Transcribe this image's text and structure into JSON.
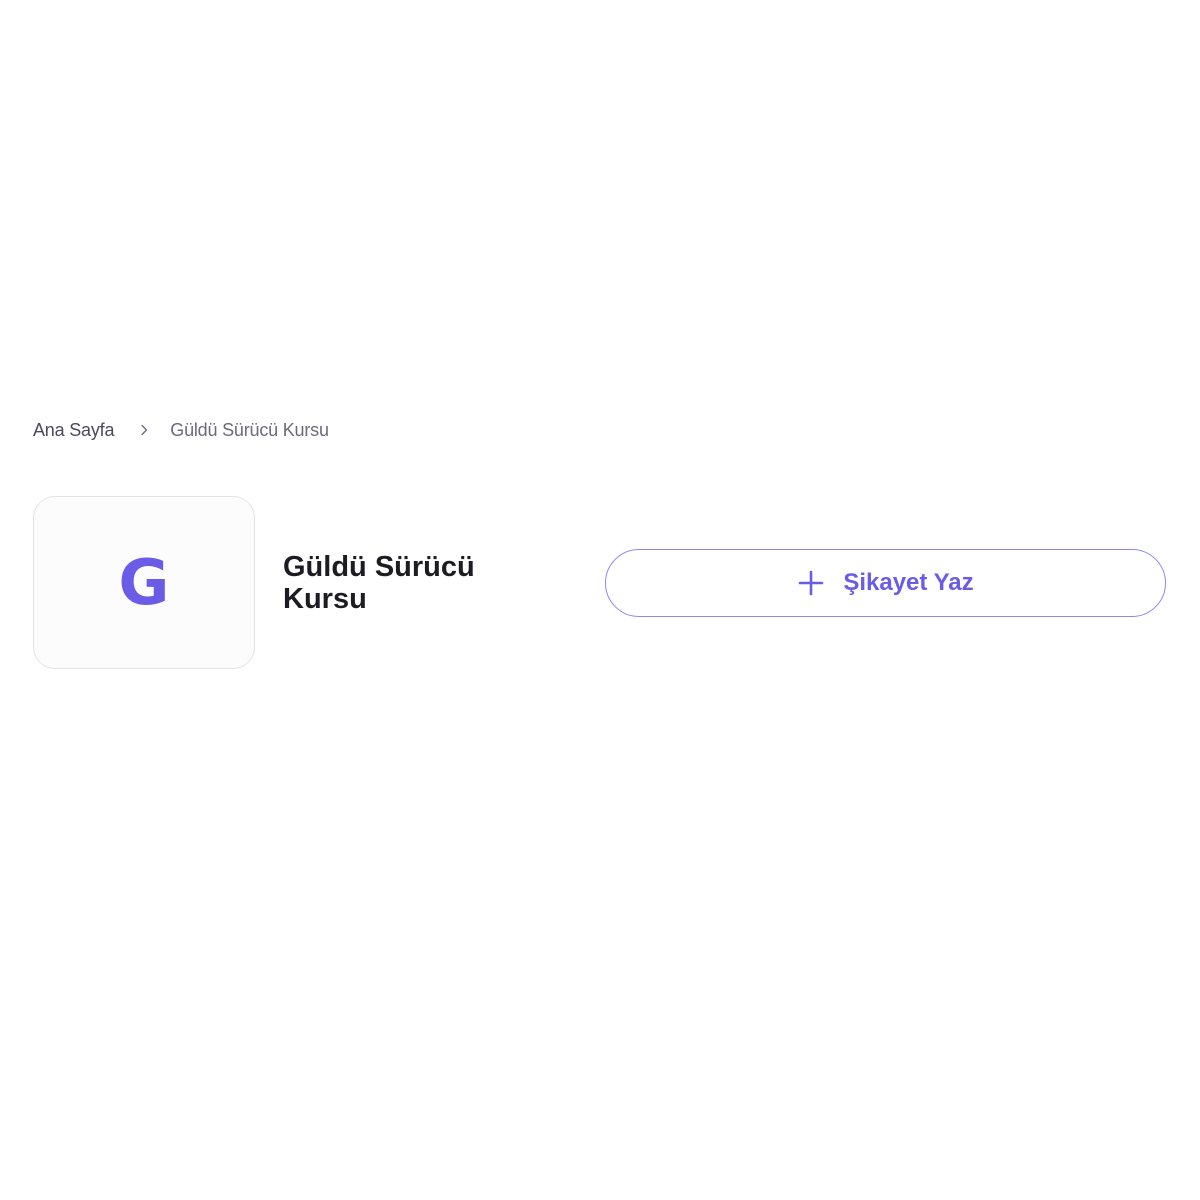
{
  "breadcrumb": {
    "home_label": "Ana Sayfa",
    "separator_icon": "chevron-right-icon",
    "current_label": "Güldü Sürücü Kursu"
  },
  "brand": {
    "logo_letter": "G",
    "name": "Güldü Sürücü Kursu"
  },
  "actions": {
    "complaint_button_label": "Şikayet Yaz",
    "complaint_button_icon": "plus-icon"
  },
  "colors": {
    "accent": "#6b5ce7",
    "button_border": "#8f86f2",
    "text_dark": "#1c1c22",
    "text_muted": "#6b6b7a"
  }
}
